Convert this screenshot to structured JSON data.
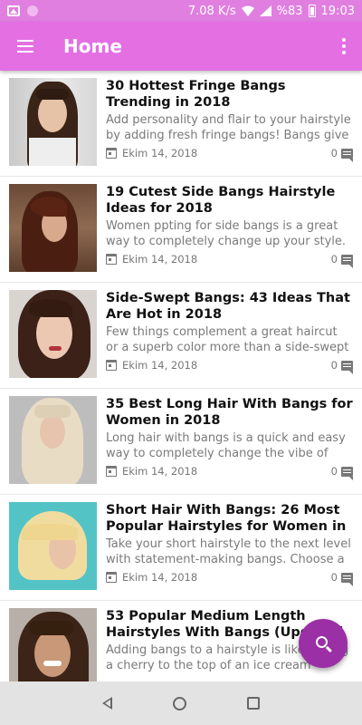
{
  "status_bar": {
    "speed": "7.08 K/s",
    "battery": "%83",
    "time": "19:03"
  },
  "app_bar": {
    "title": "Home",
    "menu_icon": "hamburger-menu-icon",
    "overflow_icon": "more-vert-icon"
  },
  "articles": [
    {
      "title": "30 Hottest Fringe Bangs Trending in 2018",
      "excerpt": "Add personality and flair to your hairstyle by adding fresh fringe bangs! Bangs give new",
      "date": "Ekim 14, 2018",
      "comments": "0"
    },
    {
      "title": "19 Cutest Side Bangs Hairstyle Ideas for 2018",
      "excerpt": "Women ppting for side bangs is a great way to completely change up your style. It’s",
      "date": "Ekim 14, 2018",
      "comments": "0"
    },
    {
      "title": "Side-Swept Bangs: 43 Ideas That Are Hot in 2018",
      "excerpt": "Few things complement a great haircut or a superb color more than a side-swept bang.",
      "date": "Ekim 14, 2018",
      "comments": "0"
    },
    {
      "title": "35 Best Long Hair With Bangs for Women in 2018",
      "excerpt": "Long hair with bangs is a quick and easy way to completely change the vibe of your",
      "date": "Ekim 14, 2018",
      "comments": "0"
    },
    {
      "title": "Short Hair With Bangs: 26 Most Popular Hairstyles for Women in",
      "excerpt": "Take your short hairstyle to the next level with statement-making bangs. Choose a full",
      "date": "Ekim 14, 2018",
      "comments": "0"
    },
    {
      "title": "53 Popular Medium Length Hairstyles With Bangs (Updated",
      "excerpt": "Adding bangs to a hairstyle is like adding a cherry to the top of an ice cream sunday –",
      "date": "",
      "comments": ""
    }
  ],
  "fab": {
    "icon": "search-icon"
  },
  "colors": {
    "status_bar": "#e07fe0",
    "app_bar": "#e46fe3",
    "fab": "#9b2fa6",
    "nav_bar": "#e3e3e3"
  }
}
